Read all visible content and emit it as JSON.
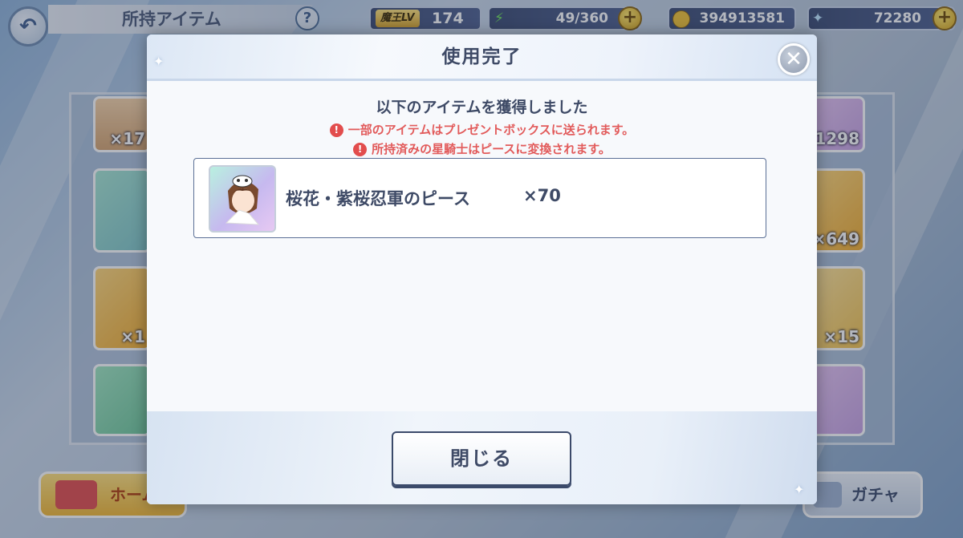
{
  "header": {
    "title": "所持アイテム",
    "level_label": "魔王LV",
    "level_value": "174",
    "stamina": "49/360",
    "coins": "394913581",
    "gems": "72280"
  },
  "background_cards": {
    "left_counts": [
      "×17",
      "",
      "×1",
      ""
    ],
    "right_counts": [
      "1298",
      "×649",
      "×15",
      ""
    ]
  },
  "bottom_nav": {
    "home_label": "ホーム",
    "gacha_label": "ガチャ"
  },
  "modal": {
    "title": "使用完了",
    "heading": "以下のアイテムを獲得しました",
    "notices": [
      "一部のアイテムはプレゼントボックスに送られます。",
      "所持済みの星騎士はピースに変換されます。"
    ],
    "items": [
      {
        "name": "桜花・紫桜忍軍のピース",
        "quantity": "×70"
      }
    ],
    "close_button_label": "閉じる"
  },
  "colors": {
    "accent_text": "#3e4a66",
    "warning": "#e25b5b",
    "gold": "#f2b733"
  },
  "icons": {
    "back": "back-arrow-icon",
    "help": "question-icon",
    "close": "close-icon",
    "stamina": "lightning-icon",
    "coin": "coin-icon",
    "gem": "star-gem-icon",
    "warning": "exclamation-icon"
  }
}
